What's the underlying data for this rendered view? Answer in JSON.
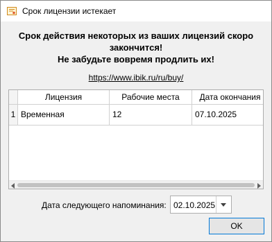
{
  "window": {
    "title": "Срок лицензии истекает",
    "icon": "certificate-app-icon"
  },
  "message": {
    "line1": "Срок действия некоторых из ваших лицензий скоро",
    "line2": "закончится!",
    "line3": "Не забудьте вовремя продлить их!"
  },
  "link": "https://www.ibik.ru/ru/buy/",
  "table": {
    "columns": [
      "Лицензия",
      "Рабочие места",
      "Дата окончания"
    ],
    "rows": [
      {
        "num": "1",
        "license": "Временная",
        "seats": "12",
        "expires": "07.10.2025"
      }
    ]
  },
  "reminder": {
    "label": "Дата следующего напоминания:",
    "date": "02.10.2025"
  },
  "buttons": {
    "ok": "OK"
  },
  "colors": {
    "accent": "#0078d7",
    "background": "#f0f0f0"
  }
}
